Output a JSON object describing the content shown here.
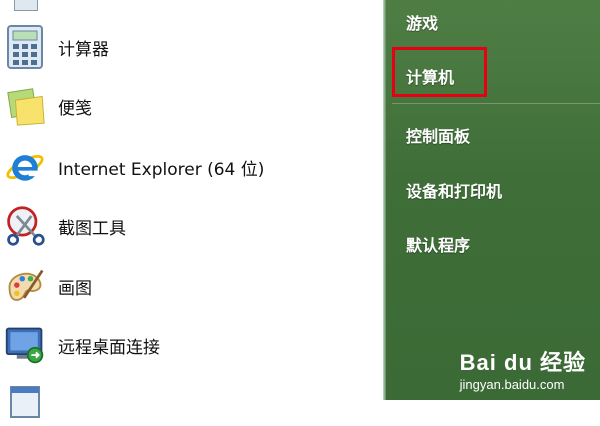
{
  "left_menu": {
    "items": [
      {
        "label": "计算器",
        "icon": "calculator-icon"
      },
      {
        "label": "便笺",
        "icon": "sticky-notes-icon"
      },
      {
        "label": "Internet Explorer (64 位)",
        "icon": "internet-explorer-icon"
      },
      {
        "label": "截图工具",
        "icon": "snipping-tool-icon"
      },
      {
        "label": "画图",
        "icon": "paint-icon"
      },
      {
        "label": "远程桌面连接",
        "icon": "remote-desktop-icon"
      },
      {
        "label": "",
        "icon": "notepad-icon"
      }
    ]
  },
  "right_menu": {
    "items": [
      {
        "label": "游戏"
      },
      {
        "label": "计算机"
      },
      {
        "label": "控制面板"
      },
      {
        "label": "设备和打印机"
      },
      {
        "label": "默认程序"
      }
    ]
  },
  "highlight_color": "#e60012",
  "watermark": {
    "brand": "Bai du 经验",
    "site": "jingyan.baidu.com"
  }
}
